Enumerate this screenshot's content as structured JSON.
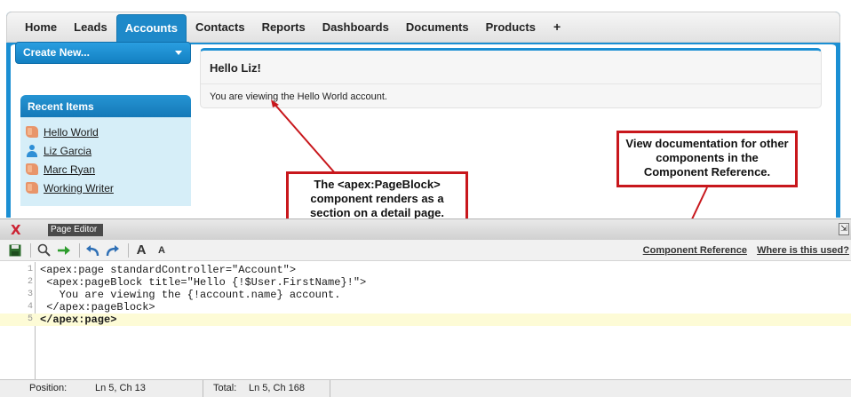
{
  "nav": {
    "tabs": [
      "Home",
      "Leads",
      "Accounts",
      "Contacts",
      "Reports",
      "Dashboards",
      "Documents",
      "Products"
    ],
    "active_tab": "Accounts",
    "add_tab_glyph": "+"
  },
  "sidebar": {
    "create_new_label": "Create New...",
    "recent_items_title": "Recent Items",
    "recent_items": [
      {
        "label": "Hello World",
        "icon": "account-icon"
      },
      {
        "label": "Liz Garcia",
        "icon": "contact-icon"
      },
      {
        "label": "Marc Ryan",
        "icon": "account-icon"
      },
      {
        "label": "Working Writer",
        "icon": "account-icon"
      }
    ]
  },
  "page_block": {
    "title": "Hello Liz!",
    "body": "You are viewing the Hello World account."
  },
  "callouts": {
    "page_block_note": "The <apex:PageBlock> component renders as a section on a detail page.",
    "reference_note": "View documentation for other components in the Component Reference."
  },
  "editor": {
    "close_glyph": "X",
    "title": "Page Editor",
    "toolbar": {
      "save": "save-icon",
      "find": "search-icon",
      "go": "arrow-right-icon",
      "undo": "undo-icon",
      "redo": "redo-icon",
      "font_bigger": "A",
      "font_smaller": "A"
    },
    "links": {
      "component_reference": "Component Reference",
      "where_used": "Where is this used?"
    },
    "code_lines": [
      {
        "n": "1",
        "text": "<apex:page standardController=\"Account\">"
      },
      {
        "n": "2",
        "text": " <apex:pageBlock title=\"Hello {!$User.FirstName}!\">"
      },
      {
        "n": "3",
        "text": "   You are viewing the {!account.name} account."
      },
      {
        "n": "4",
        "text": " </apex:pageBlock>"
      },
      {
        "n": "5",
        "text": "</apex:page>"
      }
    ],
    "status": {
      "position_label": "Position:",
      "position_value": "Ln 5, Ch 13",
      "total_label": "Total:",
      "total_value": "Ln 5, Ch 168"
    }
  },
  "colors": {
    "accent": "#1b8fd3",
    "callout_border": "#c8171c",
    "sidebar_bg": "#d6eef8"
  }
}
